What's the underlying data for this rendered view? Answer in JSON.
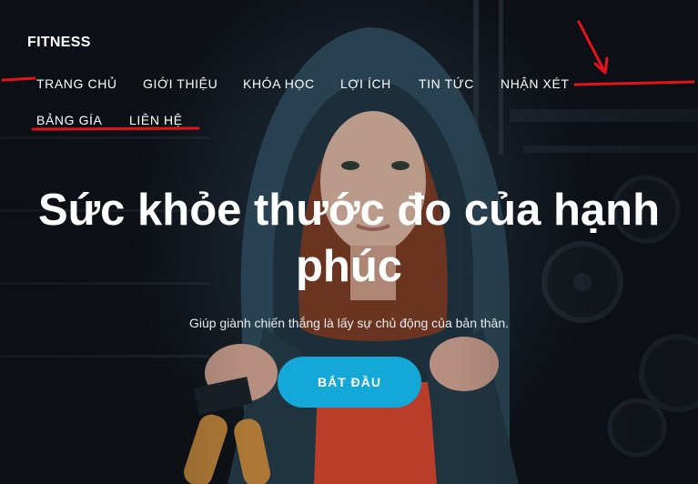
{
  "header": {
    "logo": "FITNESS"
  },
  "nav": {
    "items": [
      {
        "label": "TRANG CHỦ"
      },
      {
        "label": "GIỚI THIỆU"
      },
      {
        "label": "KHÓA HỌC"
      },
      {
        "label": "LỢI ÍCH"
      },
      {
        "label": "TIN TỨC"
      },
      {
        "label": "NHẬN XÉT"
      },
      {
        "label": "BẢNG GÍA"
      },
      {
        "label": "LIÊN HỆ"
      }
    ]
  },
  "hero": {
    "title": "Sức khỏe thước đo của hạnh phúc",
    "subtitle": "Giúp giành chiến thắng là lấy sự chủ động của bản thân.",
    "cta_label": "BẮT ĐẦU"
  },
  "colors": {
    "accent": "#14a8d8",
    "annotation": "#e3121c",
    "hoodie": "#2d4a5c",
    "shirt": "#d8452e"
  }
}
